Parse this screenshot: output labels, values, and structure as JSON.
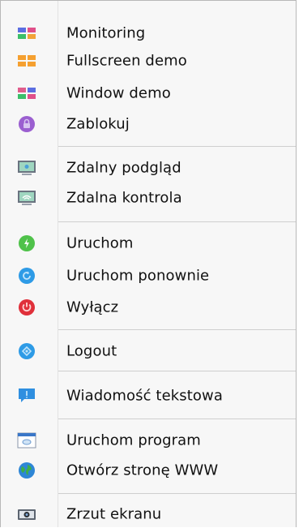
{
  "menu": {
    "items": [
      {
        "label": "Monitoring",
        "icon": "monitoring-grid-icon"
      },
      {
        "label": "Fullscreen demo",
        "icon": "fullscreen-grid-icon"
      },
      {
        "label": "Window demo",
        "icon": "window-grid-icon"
      },
      {
        "label": "Zablokuj",
        "icon": "lock-icon"
      },
      {
        "label": "Zdalny podgląd",
        "icon": "monitor-view-icon"
      },
      {
        "label": "Zdalna kontrola",
        "icon": "monitor-control-icon"
      },
      {
        "label": "Uruchom",
        "icon": "power-on-icon"
      },
      {
        "label": "Uruchom ponownie",
        "icon": "restart-icon"
      },
      {
        "label": "Wyłącz",
        "icon": "power-off-icon"
      },
      {
        "label": "Logout",
        "icon": "logout-icon"
      },
      {
        "label": "Wiadomość tekstowa",
        "icon": "message-bubble-icon"
      },
      {
        "label": "Uruchom program",
        "icon": "run-program-icon"
      },
      {
        "label": "Otwórz stronę WWW",
        "icon": "globe-icon"
      },
      {
        "label": "Zrzut ekranu",
        "icon": "camera-icon"
      }
    ]
  },
  "colors": {
    "menu_background": "#f7f7f7",
    "separator": "#cfcfcf",
    "text": "#111111"
  }
}
